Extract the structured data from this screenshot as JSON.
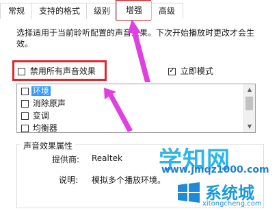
{
  "tabs": [
    {
      "label": "常规"
    },
    {
      "label": "支持的格式"
    },
    {
      "label": "级别"
    },
    {
      "label": "增强"
    },
    {
      "label": "高级"
    }
  ],
  "description": "选择适用于当前聆听配置的声音效果。下次开始播放时更改才会生效。",
  "disable_all_label": "禁用所有声音效果",
  "immediate_mode_label": "立即模式",
  "effects": [
    {
      "label": "环境"
    },
    {
      "label": "消除原声"
    },
    {
      "label": "变调"
    },
    {
      "label": "均衡器"
    },
    {
      "label": "..."
    }
  ],
  "properties": {
    "title": "声音效果属性",
    "provider_label": "提供商:",
    "provider_value": "Realtek",
    "description_label": "说明:",
    "description_value": "模拟多个播放环境。"
  },
  "watermark": {
    "line1": "学知网",
    "line2": "系统城",
    "line3": "xitongcheng.com",
    "url_text": "www.jmqz1000.com"
  },
  "annotation_color": "#e0262b",
  "arrow_color": "#e040e0",
  "selection_color": "#3399ff"
}
